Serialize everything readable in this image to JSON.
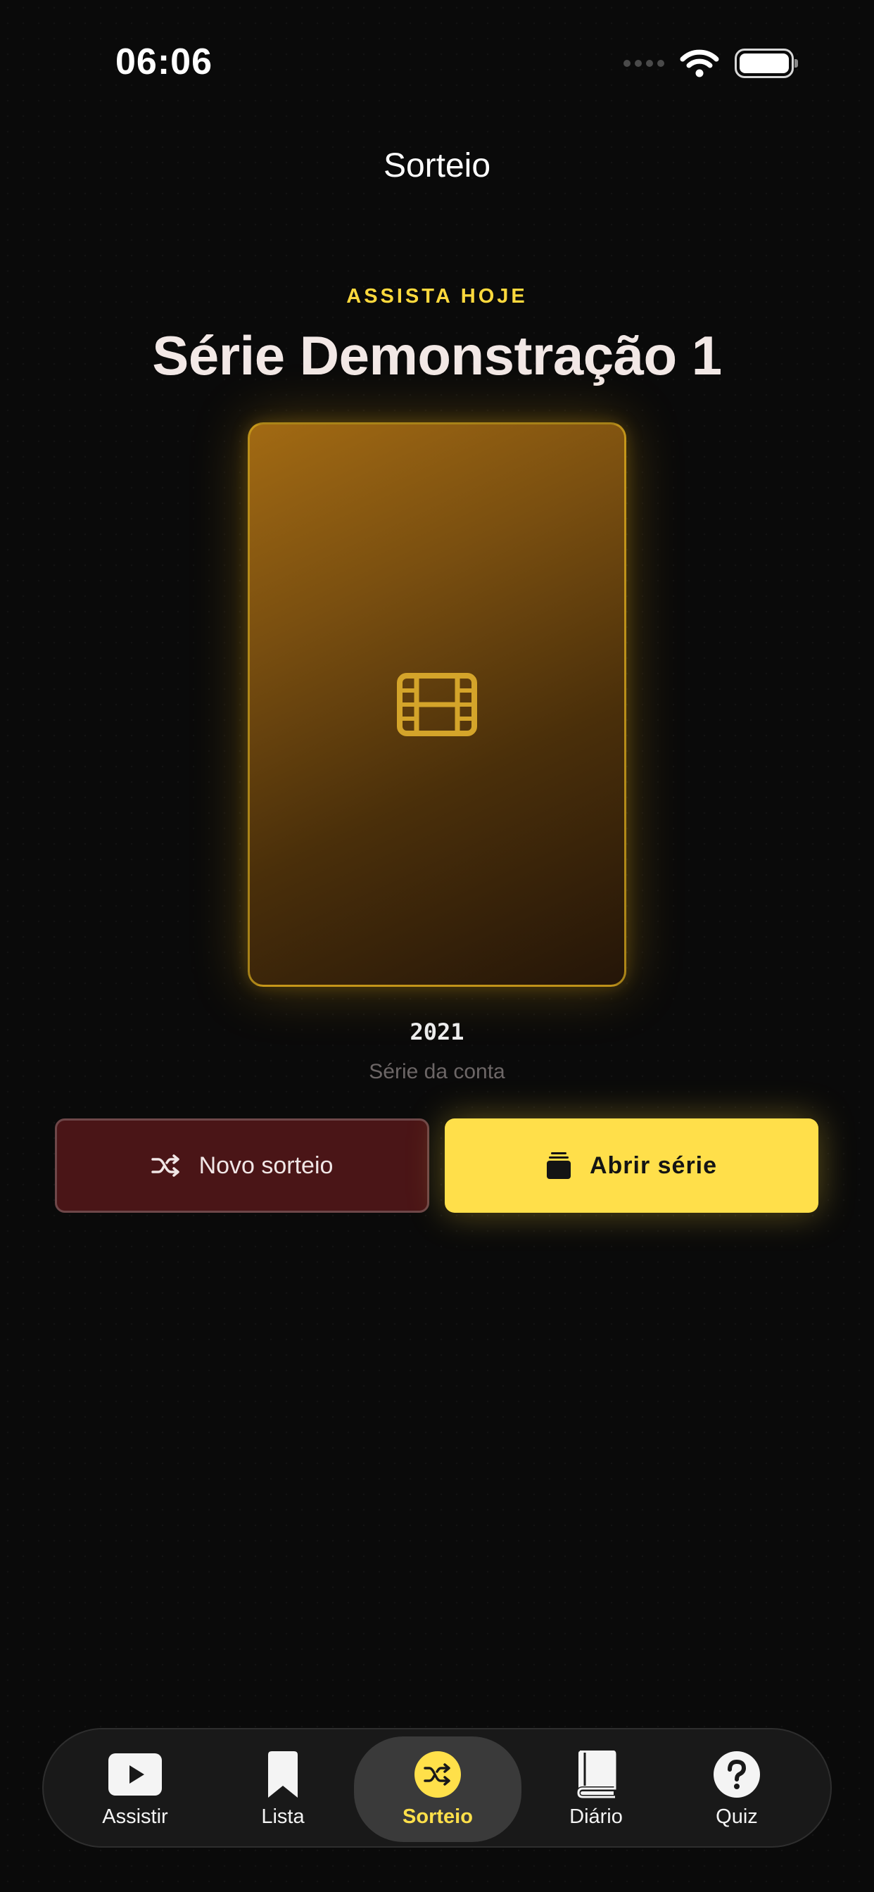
{
  "status_bar": {
    "time": "06:06"
  },
  "header": {
    "title": "Sorteio"
  },
  "pick": {
    "eyebrow": "ASSISTA HOJE",
    "title": "Série Demonstração 1",
    "year": "2021",
    "subtitle": "Série da conta",
    "poster_icon": "film-icon"
  },
  "actions": {
    "secondary": {
      "label": "Novo sorteio",
      "icon": "shuffle-icon"
    },
    "primary": {
      "label": "Abrir série",
      "icon": "stack-icon"
    }
  },
  "tabs": [
    {
      "label": "Assistir",
      "icon": "play-icon"
    },
    {
      "label": "Lista",
      "icon": "bookmark-icon"
    },
    {
      "label": "Sorteio",
      "icon": "shuffle-icon",
      "active": true
    },
    {
      "label": "Diário",
      "icon": "book-icon"
    },
    {
      "label": "Quiz",
      "icon": "question-icon"
    }
  ],
  "colors": {
    "accent": "#ffdf4a",
    "background": "#0a0a0a",
    "secondary_button": "#4a1517"
  }
}
